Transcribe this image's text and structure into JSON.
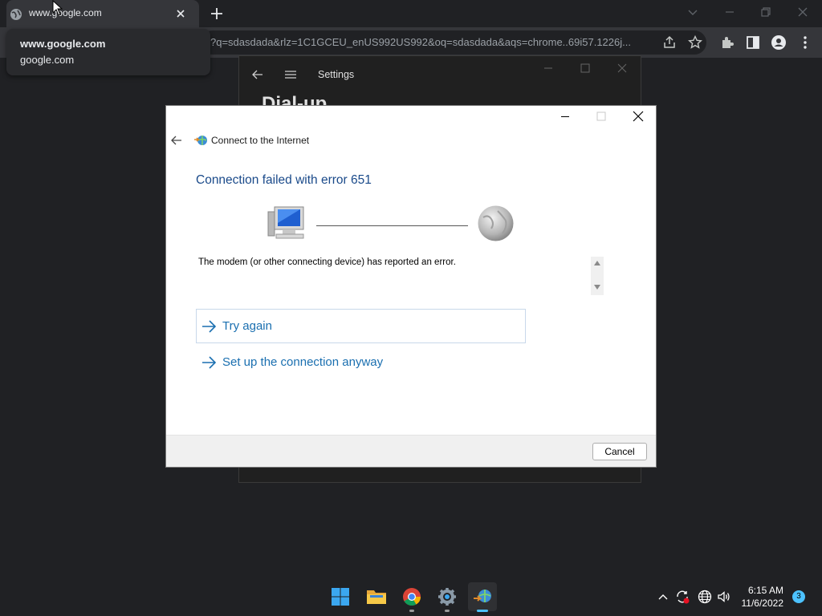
{
  "browser": {
    "tab_title": "www.google.com",
    "url": "?q=sdasdada&rlz=1C1GCEU_enUS992US992&oq=sdasdada&aqs=chrome..69i57.1226j...",
    "tooltip_title": "www.google.com",
    "tooltip_subtitle": "google.com"
  },
  "settings_window": {
    "title": "Settings",
    "page_heading": "Dial-up"
  },
  "dialog": {
    "title": "Connect to the Internet",
    "heading": "Connection failed with error 651",
    "message": "The modem (or other connecting device) has reported an error.",
    "try_again": "Try again",
    "setup_anyway": "Set up the connection anyway",
    "cancel": "Cancel"
  },
  "taskbar": {
    "time": "6:15 AM",
    "date": "11/6/2022",
    "notification_count": "3",
    "apps": [
      "start-icon",
      "file-explorer-icon",
      "chrome-icon",
      "settings-icon",
      "network-connection-icon"
    ]
  },
  "colors": {
    "heading_blue": "#1a4a8a",
    "link_blue": "#1a6fb0",
    "badge": "#4cc2ff"
  }
}
